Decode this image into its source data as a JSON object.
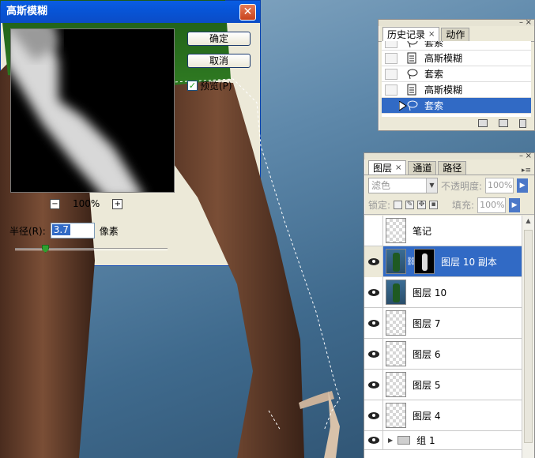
{
  "history_panel": {
    "tabs": [
      {
        "label": "历史记录",
        "active": true
      },
      {
        "label": "动作",
        "active": false
      }
    ],
    "close_symbol": "×",
    "states": [
      {
        "label": "套索",
        "icon": "lasso-icon",
        "selected": false
      },
      {
        "label": "高斯模糊",
        "icon": "filter-icon",
        "selected": false
      },
      {
        "label": "套索",
        "icon": "lasso-icon",
        "selected": false
      },
      {
        "label": "高斯模糊",
        "icon": "filter-icon",
        "selected": false
      },
      {
        "label": "套索",
        "icon": "lasso-icon",
        "selected": true
      }
    ]
  },
  "layers_panel": {
    "tabs": [
      {
        "label": "图层",
        "active": true
      },
      {
        "label": "通道",
        "active": false
      },
      {
        "label": "路径",
        "active": false
      }
    ],
    "close_symbol": "×",
    "blend_mode": "滤色",
    "opacity_label": "不透明度:",
    "opacity_value": "100%",
    "lock_label": "锁定:",
    "fill_label": "填充:",
    "fill_value": "100%",
    "layers": [
      {
        "name": "笔记",
        "visible": false,
        "selected": false
      },
      {
        "name": "图层 10 副本",
        "visible": true,
        "selected": true
      },
      {
        "name": "图层 10",
        "visible": true,
        "selected": false
      },
      {
        "name": "图层 7",
        "visible": true,
        "selected": false
      },
      {
        "name": "图层 6",
        "visible": true,
        "selected": false
      },
      {
        "name": "图层 5",
        "visible": true,
        "selected": false
      },
      {
        "name": "图层 4",
        "visible": true,
        "selected": false
      },
      {
        "name": "组 1",
        "visible": true,
        "selected": false
      }
    ]
  },
  "gaussian_blur_dialog": {
    "title": "高斯模糊",
    "ok_label": "确定",
    "cancel_label": "取消",
    "preview_label": "预览(P)",
    "preview_checked": true,
    "zoom_level": "100%",
    "zoom_out_symbol": "−",
    "zoom_in_symbol": "+",
    "radius_label": "半径(R):",
    "radius_value": "3.7",
    "radius_unit": "像素",
    "close_symbol": "✕"
  },
  "colors": {
    "selection_blue": "#316ac5",
    "dialog_title_blue": "#0a5de3",
    "palette_bg": "#ece9d8"
  }
}
